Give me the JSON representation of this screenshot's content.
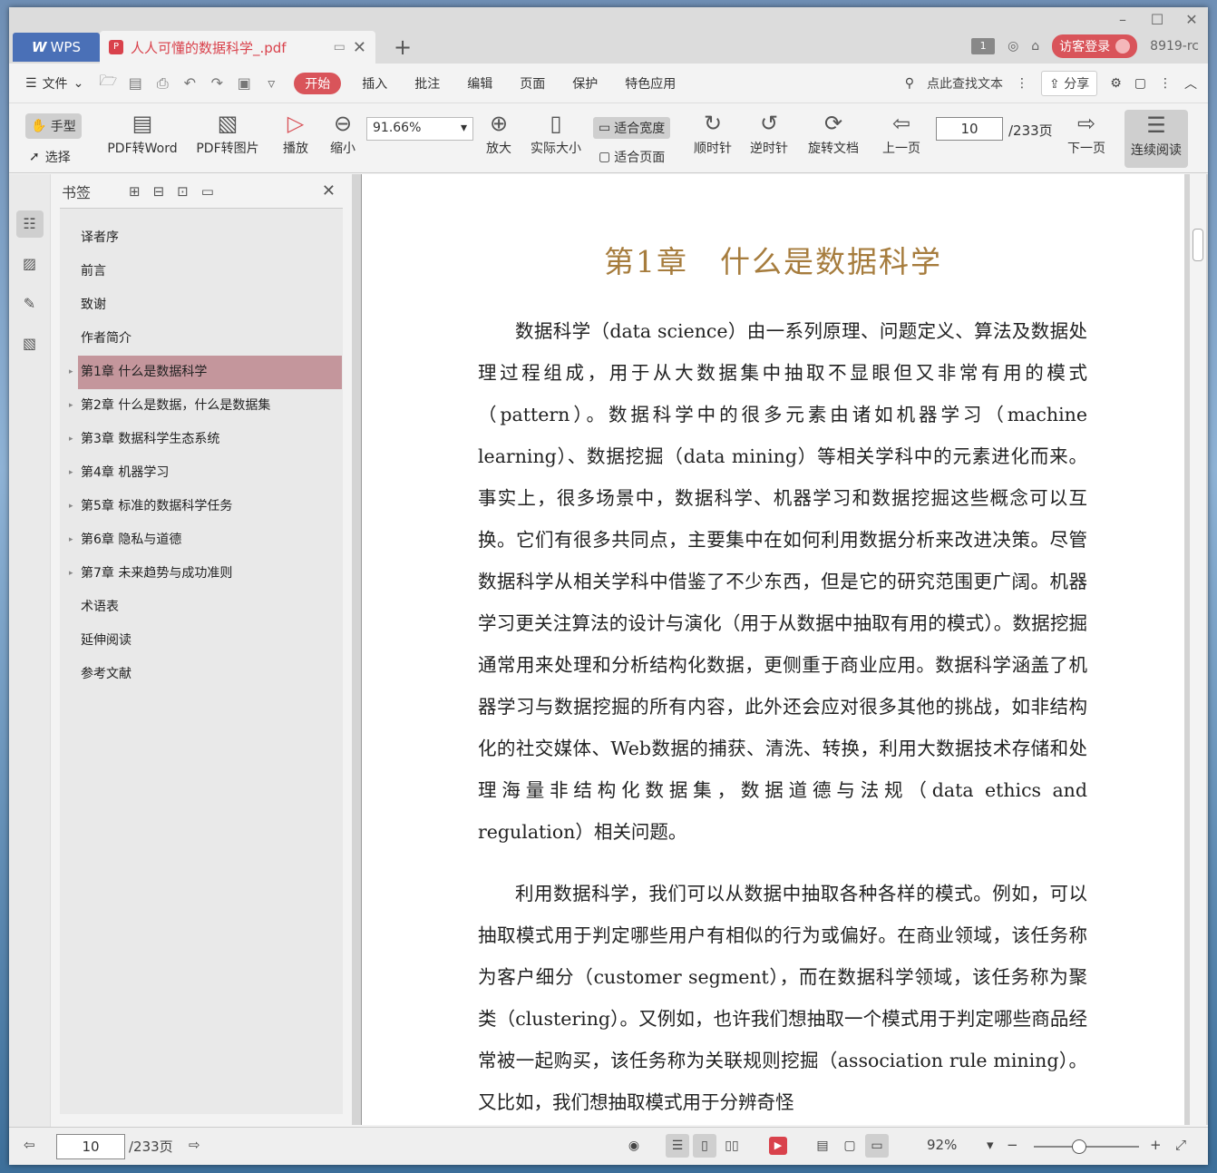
{
  "titlebar": {
    "wps_label": "WPS",
    "doc_tab_title": "人人可懂的数据科学_.pdf",
    "login_label": "访客登录",
    "user_id": "8919-rc",
    "page_badge": "1"
  },
  "menu": {
    "file_label": "文件",
    "tabs": [
      "开始",
      "插入",
      "批注",
      "编辑",
      "页面",
      "保护",
      "特色应用"
    ],
    "search_label": "点此查找文本",
    "share_label": "分享"
  },
  "toolbar": {
    "hand_label": "手型",
    "select_label": "选择",
    "pdf_to_word": "PDF转Word",
    "pdf_to_image": "PDF转图片",
    "play": "播放",
    "zoom_out": "缩小",
    "zoom_value": "91.66%",
    "zoom_in": "放大",
    "actual_size": "实际大小",
    "fit_width": "适合宽度",
    "fit_page": "适合页面",
    "clockwise": "顺时针",
    "counterclockwise": "逆时针",
    "rotate_doc": "旋转文档",
    "prev_page": "上一页",
    "current_page": "10",
    "total_pages": "/233页",
    "next_page": "下一页",
    "continuous": "连续阅读"
  },
  "bookmarks": {
    "title": "书签",
    "items": [
      {
        "label": "译者序",
        "expandable": false,
        "selected": false
      },
      {
        "label": "前言",
        "expandable": false,
        "selected": false
      },
      {
        "label": "致谢",
        "expandable": false,
        "selected": false
      },
      {
        "label": "作者简介",
        "expandable": false,
        "selected": false
      },
      {
        "label": "第1章 什么是数据科学",
        "expandable": true,
        "selected": true
      },
      {
        "label": "第2章 什么是数据，什么是数据集",
        "expandable": true,
        "selected": false
      },
      {
        "label": "第3章 数据科学生态系统",
        "expandable": true,
        "selected": false
      },
      {
        "label": "第4章 机器学习",
        "expandable": true,
        "selected": false
      },
      {
        "label": "第5章 标准的数据科学任务",
        "expandable": true,
        "selected": false
      },
      {
        "label": "第6章 隐私与道德",
        "expandable": true,
        "selected": false
      },
      {
        "label": "第7章 未来趋势与成功准则",
        "expandable": true,
        "selected": false
      },
      {
        "label": "术语表",
        "expandable": false,
        "selected": false
      },
      {
        "label": "延伸阅读",
        "expandable": false,
        "selected": false
      },
      {
        "label": "参考文献",
        "expandable": false,
        "selected": false
      }
    ]
  },
  "document": {
    "chapter_title": "第1章　什么是数据科学",
    "paragraph1": "数据科学（data science）由一系列原理、问题定义、算法及数据处理过程组成，用于从大数据集中抽取不显眼但又非常有用的模式（pattern）。数据科学中的很多元素由诸如机器学习（machine learning）、数据挖掘（data mining）等相关学科中的元素进化而来。事实上，很多场景中，数据科学、机器学习和数据挖掘这些概念可以互换。它们有很多共同点，主要集中在如何利用数据分析来改进决策。尽管数据科学从相关学科中借鉴了不少东西，但是它的研究范围更广阔。机器学习更关注算法的设计与演化（用于从数据中抽取有用的模式）。数据挖掘通常用来处理和分析结构化数据，更侧重于商业应用。数据科学涵盖了机器学习与数据挖掘的所有内容，此外还会应对很多其他的挑战，如非结构化的社交媒体、Web数据的捕获、清洗、转换，利用大数据技术存储和处理海量非结构化数据集，数据道德与法规（data ethics and regulation）相关问题。",
    "paragraph2": "利用数据科学，我们可以从数据中抽取各种各样的模式。例如，可以抽取模式用于判定哪些用户有相似的行为或偏好。在商业领域，该任务称为客户细分（customer segment），而在数据科学领域，该任务称为聚类（clustering）。又例如，也许我们想抽取一个模式用于判定哪些商品经常被一起购买，该任务称为关联规则挖掘（association rule mining）。又比如，我们想抽取模式用于分辨奇怪"
  },
  "statusbar": {
    "current_page": "10",
    "total_pages": "/233页",
    "zoom_percent": "92%"
  },
  "colors": {
    "accent": "#d9545a",
    "selected_bookmark": "#c4969c",
    "chapter_title": "#a67c3d",
    "wps_tab": "#4a70b7"
  }
}
